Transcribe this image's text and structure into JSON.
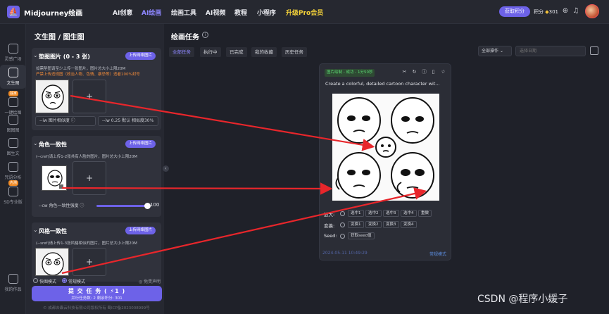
{
  "topnav": {
    "brand": "Midjourney绘画",
    "items": [
      {
        "label": "AI创意"
      },
      {
        "label": "AI绘画"
      },
      {
        "label": "绘画工具"
      },
      {
        "label": "AI视频"
      },
      {
        "label": "教程"
      },
      {
        "label": "小程序"
      },
      {
        "label": "升级Pro会员"
      }
    ],
    "active_index": 1,
    "credits_button": "获取积分",
    "points_label": "积分",
    "points_value": "301"
  },
  "rail": [
    {
      "label": "灵感广场",
      "icon": "grid-icon"
    },
    {
      "label": "文生图",
      "icon": "image-icon",
      "active": true
    },
    {
      "label": "一键绘图",
      "icon": "wand-icon",
      "badge": "独家"
    },
    {
      "label": "图图图",
      "icon": "gallery-icon"
    },
    {
      "label": "图生文",
      "icon": "doc-icon"
    },
    {
      "label": "咒语分析",
      "icon": "analyze-icon"
    },
    {
      "label": "SD专业版",
      "icon": "sd-icon",
      "badge": "内测"
    },
    {
      "label": "我的作品",
      "icon": "works-icon"
    }
  ],
  "panel": {
    "title": "文生图 / 图生图",
    "pad": {
      "title": "垫图图片 (0 - 3 张)",
      "button": "上传网络图片",
      "desc": "如需垫图请至少上传一张图片，图片总大小上限20M",
      "warn": "严禁上传违规图（政治人物、色情、暴恐等）违者100%封号",
      "iw_select": "--iw 图片相似度",
      "iw_value": "--iw 0.25 默认 相似度30%"
    },
    "char": {
      "title": "角色一致性",
      "button": "上传网络图片",
      "desc": "(--cref)请上传1-2张共有人脸的图片，图片总大小上限20M",
      "slider_label": "--cw 角色一致性强度",
      "slider_value": "100"
    },
    "style": {
      "title": "风格一致性",
      "button": "上传网络图片",
      "desc": "(--sref)请上传1-3张风格相似的图片，图片总大小上限20M"
    },
    "mode_fast": "快图模式",
    "mode_normal": "常规模式",
    "disclaimer": "免责声明",
    "submit": "提 交 任 务 ( ⚡1 )",
    "submit_sub": "并行任务数: 2    剩余积分: 301",
    "icp": "© 成都去囊云科技有限公司版权所有 蜀ICP备2023008999号"
  },
  "main": {
    "title": "绘画任务",
    "tabs": [
      {
        "label": "全部任务"
      },
      {
        "label": "执行中"
      },
      {
        "label": "已完成"
      },
      {
        "label": "我的收藏"
      },
      {
        "label": "历史任务"
      }
    ],
    "ops": "全部操作",
    "date_placeholder": "选择日期"
  },
  "task": {
    "status": "图片绘制 - 成功 - 1分50秒",
    "prompt": "Create a colorful, detailed cartoon character wit...",
    "zoom_label": "放大:",
    "zoom": [
      "选中1",
      "选中2",
      "选中3",
      "选中4",
      "重做"
    ],
    "vary_label": "变换:",
    "vary": [
      "变换1",
      "变换2",
      "变换3",
      "变换4"
    ],
    "seed_label": "Seed:",
    "seed_button": "获取seed值",
    "date": "2024-05-11 10:49:29",
    "mode": "常规模式"
  },
  "watermark": "CSDN @程序小媛子",
  "colors": {
    "accent": "#6d62e8",
    "arrow": "#e8262b",
    "success": "#5ddc74"
  }
}
